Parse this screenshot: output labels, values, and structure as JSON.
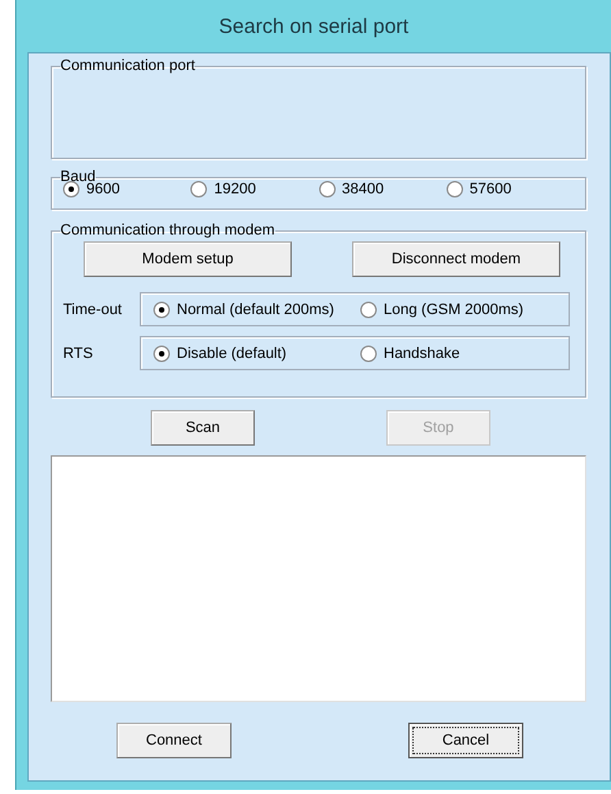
{
  "window": {
    "title": "Search on serial port"
  },
  "communication_port": {
    "label": "Communication port"
  },
  "baud": {
    "label": "Baud",
    "options": [
      {
        "label": "9600",
        "selected": true
      },
      {
        "label": "19200",
        "selected": false
      },
      {
        "label": "38400",
        "selected": false
      },
      {
        "label": "57600",
        "selected": false
      }
    ]
  },
  "modem": {
    "label": "Communication through modem",
    "buttons": [
      {
        "label": "Modem setup",
        "disabled": false
      },
      {
        "label": "Disconnect modem",
        "disabled": false
      }
    ],
    "settings": [
      {
        "label": "Time-out",
        "options": [
          {
            "label": "Normal (default 200ms)",
            "selected": true
          },
          {
            "label": "Long (GSM 2000ms)",
            "selected": false
          }
        ]
      },
      {
        "label": "RTS",
        "options": [
          {
            "label": "Disable (default)",
            "selected": true
          },
          {
            "label": "Handshake",
            "selected": false
          }
        ]
      }
    ]
  },
  "scan_buttons": [
    {
      "label": "Scan",
      "disabled": false
    },
    {
      "label": "Stop",
      "disabled": true
    }
  ],
  "footer_buttons": [
    {
      "label": "Connect",
      "focused": false
    },
    {
      "label": "Cancel",
      "focused": true
    }
  ]
}
